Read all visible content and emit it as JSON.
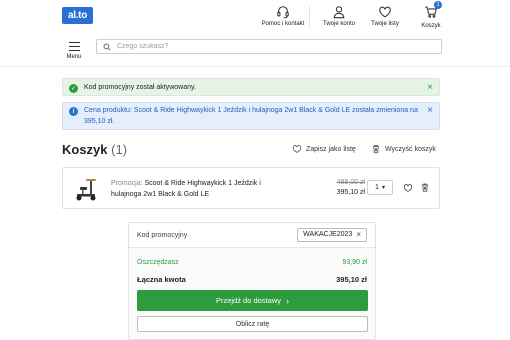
{
  "header": {
    "logo_text": "al.to",
    "nav": [
      {
        "label": "Pomoc i kontakt",
        "icon": "headset-icon"
      },
      {
        "label": "Twoje konto",
        "icon": "user-icon"
      },
      {
        "label": "Twoje listy",
        "icon": "heart-icon"
      },
      {
        "label": "Koszyk",
        "icon": "cart-icon",
        "badge": "1"
      }
    ],
    "menu_label": "Menu",
    "search_placeholder": "Czego szukasz?"
  },
  "alerts": [
    {
      "type": "success",
      "text": "Kod promocyjny został aktywowany.",
      "close": "×"
    },
    {
      "type": "info",
      "text": "Cena produktu: Scoot & Ride Highwaykick 1 Jeździk i hulajnoga 2w1 Black & Gold LE została zmieniona na 395,10 zł.",
      "close": "×"
    }
  ],
  "cart": {
    "title": "Koszyk",
    "count": "(1)",
    "save_list_label": "Zapisz jako listę",
    "clear_label": "Wyczyść koszyk"
  },
  "item": {
    "promo_prefix": "Promocja:",
    "name": "Scoot & Ride Highwaykick 1 Jeździk i hulajnoga 2w1 Black & Gold LE",
    "old_price": "489,00 zł",
    "price": "395,10 zł",
    "quantity": "1"
  },
  "summary": {
    "promo_label": "Kod promocyjny",
    "promo_code": "WAKACJE2023",
    "promo_remove": "×",
    "savings_label": "Oszczędzasz",
    "savings_value": "93,90 zł",
    "total_label": "Łączna kwota",
    "total_value": "395,10 zł",
    "checkout_label": "Przejdź do dostawy",
    "installment_label": "Oblicz ratę"
  },
  "colors": {
    "brand": "#2a6fd6",
    "success": "#2e9b3e",
    "success_bg": "#e6f4e7",
    "info_bg": "#e4effb"
  }
}
